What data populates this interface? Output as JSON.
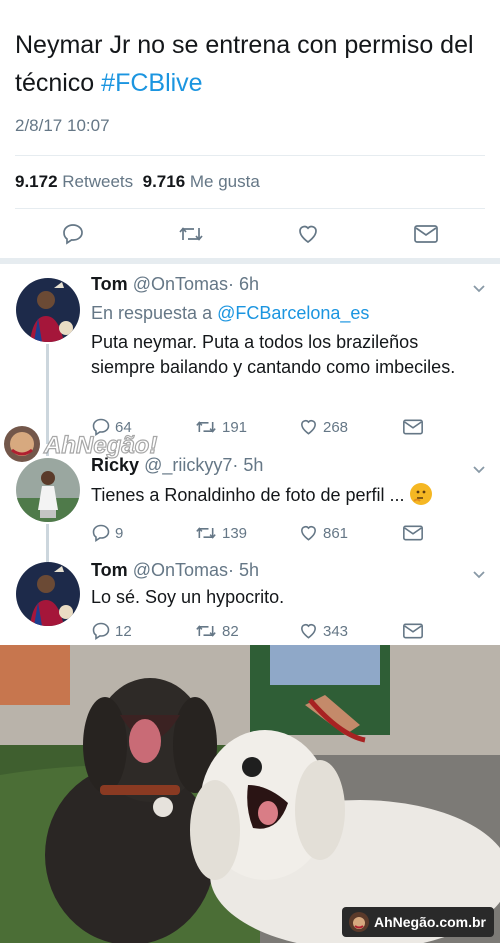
{
  "tweet": {
    "text": "Neymar Jr no se entrena con permiso del técnico ",
    "hashtag": "#FCBlive",
    "timestamp": "2/8/17 10:07",
    "retweets_count": "9.172",
    "retweets_label": "Retweets",
    "likes_count": "9.716",
    "likes_label": "Me gusta"
  },
  "replies": [
    {
      "name": "Tom",
      "handle": "@OnTomas",
      "time": "· 6h",
      "in_reply_prefix": "En respuesta a ",
      "in_reply_mention": "@FCBarcelona_es",
      "text": "Puta neymar. Puta a todos los brazileños siempre bailando y cantando como imbeciles.",
      "reply_count": "64",
      "retweet_count": "191",
      "like_count": "268"
    },
    {
      "name": "Ricky",
      "handle": "@_riickyy7",
      "time": "· 5h",
      "text": "Tienes a Ronaldinho de foto de perfil ...",
      "emoji": "thinking-face-emoji",
      "reply_count": "9",
      "retweet_count": "139",
      "like_count": "861"
    },
    {
      "name": "Tom",
      "handle": "@OnTomas",
      "time": "· 5h",
      "text": "Lo sé. Soy un hypocrito.",
      "reply_count": "12",
      "retweet_count": "82",
      "like_count": "343"
    }
  ],
  "watermark": {
    "text": "AhNegão!"
  },
  "footer": {
    "badge_text": "AhNegão.com.br"
  },
  "colors": {
    "link": "#1b95e0",
    "secondary": "#657786",
    "divider": "#e6ecf0"
  }
}
